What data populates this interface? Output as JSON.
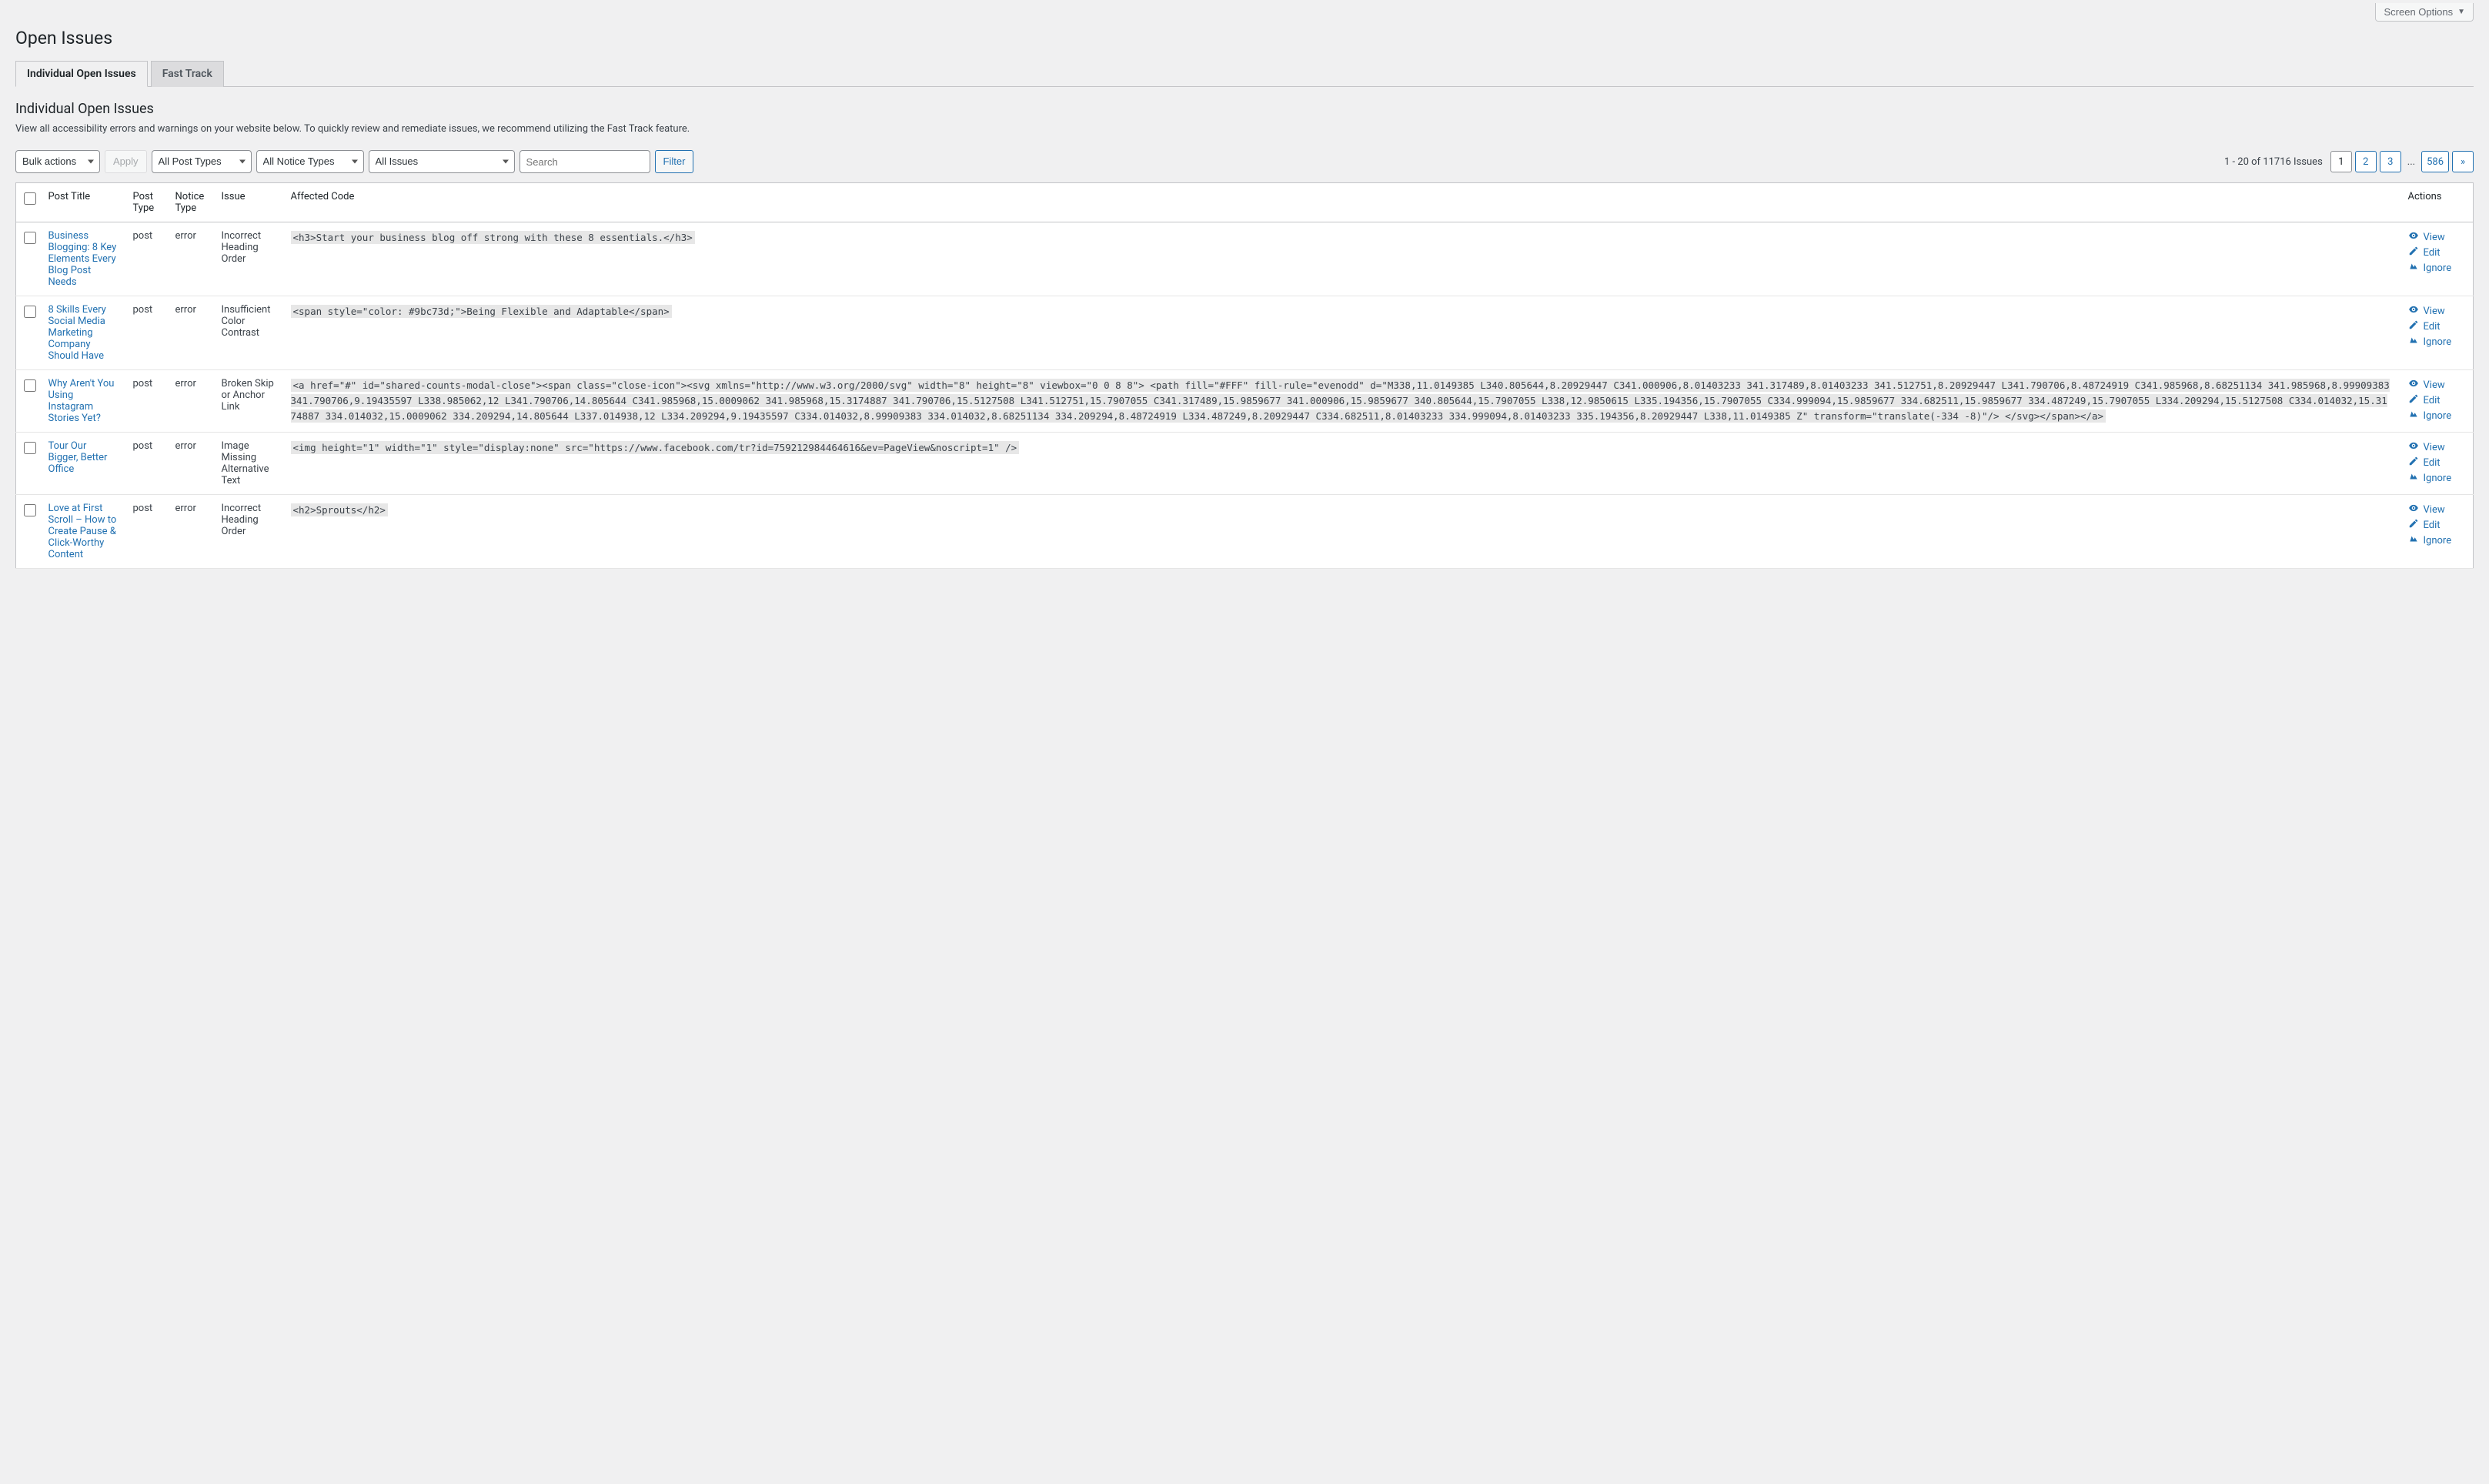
{
  "topbar": {
    "screen_options": "Screen Options"
  },
  "page_title": "Open Issues",
  "tabs": [
    {
      "label": "Individual Open Issues",
      "active": true
    },
    {
      "label": "Fast Track",
      "active": false
    }
  ],
  "section_title": "Individual Open Issues",
  "description": "View all accessibility errors and warnings on your website below. To quickly review and remediate issues, we recommend utilizing the Fast Track feature.",
  "controls": {
    "bulk_actions": "Bulk actions",
    "apply": "Apply",
    "post_types": "All Post Types",
    "notice_types": "All Notice Types",
    "issues": "All Issues",
    "search_placeholder": "Search",
    "filter": "Filter"
  },
  "pagination": {
    "summary": "1 - 20 of 11716 Issues",
    "current": "1",
    "pages": [
      "2",
      "3"
    ],
    "ellipsis": "...",
    "last": "586",
    "next": "»"
  },
  "columns": {
    "post_title": "Post Title",
    "post_type": "Post Type",
    "notice_type": "Notice Type",
    "issue": "Issue",
    "affected_code": "Affected Code",
    "actions": "Actions"
  },
  "action_labels": {
    "view": "View",
    "edit": "Edit",
    "ignore": "Ignore"
  },
  "rows": [
    {
      "title": "Business Blogging: 8 Key Elements Every Blog Post Needs",
      "post_type": "post",
      "notice_type": "error",
      "issue": "Incorrect Heading Order",
      "code": "<h3>Start your business blog off strong with these 8 essentials.</h3>"
    },
    {
      "title": "8 Skills Every Social Media Marketing Company Should Have",
      "post_type": "post",
      "notice_type": "error",
      "issue": "Insufficient Color Contrast",
      "code": "<span style=\"color: #9bc73d;\">Being Flexible and Adaptable</span>"
    },
    {
      "title": "Why Aren't You Using Instagram Stories Yet?",
      "post_type": "post",
      "notice_type": "error",
      "issue": "Broken Skip or Anchor Link",
      "code": "<a href=\"#\" id=\"shared-counts-modal-close\"><span class=\"close-icon\"><svg xmlns=\"http://www.w3.org/2000/svg\" width=\"8\" height=\"8\" viewbox=\"0 0 8 8\"> <path fill=\"#FFF\" fill-rule=\"evenodd\" d=\"M338,11.0149385 L340.805644,8.20929447 C341.000906,8.01403233 341.317489,8.01403233 341.512751,8.20929447 L341.790706,8.48724919 C341.985968,8.68251134 341.985968,8.99909383 341.790706,9.19435597 L338.985062,12 L341.790706,14.805644 C341.985968,15.0009062 341.985968,15.3174887 341.790706,15.5127508 L341.512751,15.7907055 C341.317489,15.9859677 341.000906,15.9859677 340.805644,15.7907055 L338,12.9850615 L335.194356,15.7907055 C334.999094,15.9859677 334.682511,15.9859677 334.487249,15.7907055 L334.209294,15.5127508 C334.014032,15.3174887 334.014032,15.0009062 334.209294,14.805644 L337.014938,12 L334.209294,9.19435597 C334.014032,8.99909383 334.014032,8.68251134 334.209294,8.48724919 L334.487249,8.20929447 C334.682511,8.01403233 334.999094,8.01403233 335.194356,8.20929447 L338,11.0149385 Z\" transform=\"translate(-334 -8)\"/> </svg></span></a>"
    },
    {
      "title": "Tour Our Bigger, Better Office",
      "post_type": "post",
      "notice_type": "error",
      "issue": "Image Missing Alternative Text",
      "code": "<img height=\"1\" width=\"1\" style=\"display:none\" src=\"https://www.facebook.com/tr?id=759212984464616&ev=PageView&noscript=1\" />"
    },
    {
      "title": "Love at First Scroll – How to Create Pause & Click-Worthy Content",
      "post_type": "post",
      "notice_type": "error",
      "issue": "Incorrect Heading Order",
      "code": "<h2>Sprouts</h2>"
    }
  ]
}
